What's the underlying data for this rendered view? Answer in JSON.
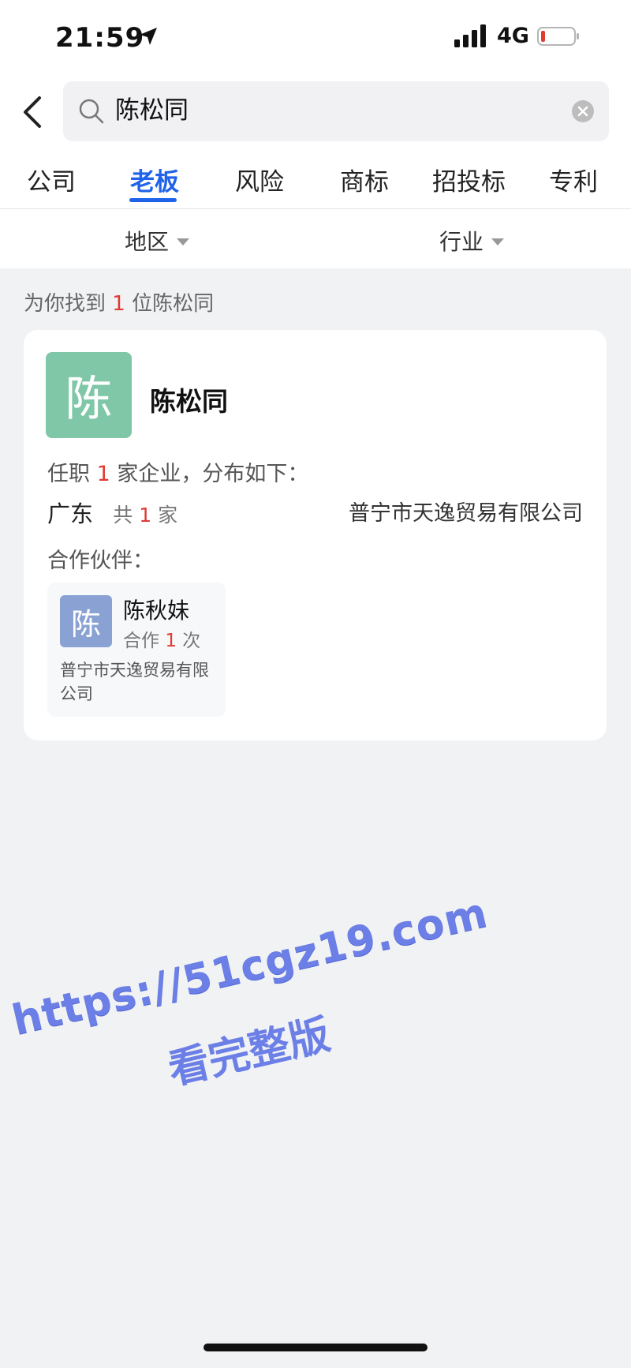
{
  "status_bar": {
    "time": "21:59",
    "network": "4G",
    "icons": [
      "location-arrow-icon",
      "signal-bars-icon",
      "battery-low-icon"
    ]
  },
  "search": {
    "query": "陈松同",
    "icons": [
      "back-chevron-icon",
      "search-icon",
      "clear-icon"
    ]
  },
  "tabs": [
    {
      "label": "公司"
    },
    {
      "label": "老板",
      "active": true
    },
    {
      "label": "风险"
    },
    {
      "label": "商标"
    },
    {
      "label": "招投标"
    },
    {
      "label": "专利"
    }
  ],
  "filters": {
    "region": "地区",
    "industry": "行业"
  },
  "results": {
    "prefix": "为你找到",
    "count": "1",
    "suffix": "位陈松同"
  },
  "person": {
    "avatar_char": "陈",
    "name": "陈松同",
    "jobs_prefix": "任职",
    "jobs_count": "1",
    "jobs_suffix": "家企业，分布如下：",
    "province": "广东",
    "province_prefix": "共",
    "province_count": "1",
    "province_suffix": "家",
    "company": "普宁市天逸贸易有限公司",
    "partners_label": "合作伙伴："
  },
  "partner": {
    "avatar_char": "陈",
    "name": "陈秋妹",
    "coop_prefix": "合作",
    "coop_count": "1",
    "coop_suffix": "次",
    "company": "普宁市天逸贸易有限公司"
  },
  "watermark": {
    "line1": "https://51cgz19.com",
    "line2": "看完整版"
  },
  "colors": {
    "accent": "#1e63e9",
    "highlight_red": "#e03b33",
    "avatar_green": "#7fc7a6",
    "avatar_blue": "#8aa2d3",
    "watermark": "#6b7fe6"
  }
}
